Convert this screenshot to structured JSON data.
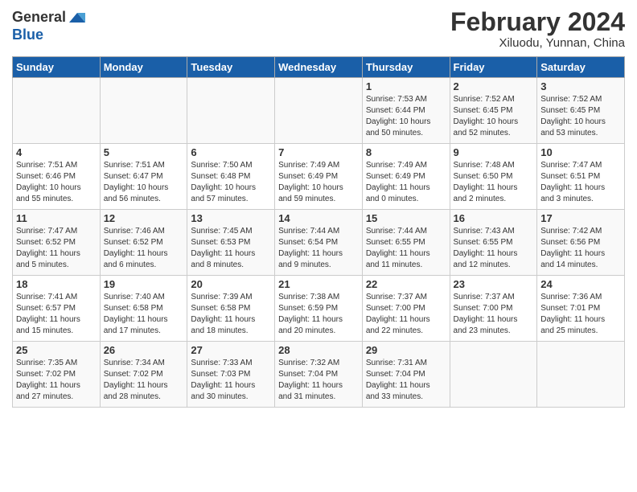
{
  "header": {
    "logo_line1": "General",
    "logo_line2": "Blue",
    "month": "February 2024",
    "location": "Xiluodu, Yunnan, China"
  },
  "days_of_week": [
    "Sunday",
    "Monday",
    "Tuesday",
    "Wednesday",
    "Thursday",
    "Friday",
    "Saturday"
  ],
  "weeks": [
    [
      {
        "num": "",
        "info": ""
      },
      {
        "num": "",
        "info": ""
      },
      {
        "num": "",
        "info": ""
      },
      {
        "num": "",
        "info": ""
      },
      {
        "num": "1",
        "info": "Sunrise: 7:53 AM\nSunset: 6:44 PM\nDaylight: 10 hours\nand 50 minutes."
      },
      {
        "num": "2",
        "info": "Sunrise: 7:52 AM\nSunset: 6:45 PM\nDaylight: 10 hours\nand 52 minutes."
      },
      {
        "num": "3",
        "info": "Sunrise: 7:52 AM\nSunset: 6:45 PM\nDaylight: 10 hours\nand 53 minutes."
      }
    ],
    [
      {
        "num": "4",
        "info": "Sunrise: 7:51 AM\nSunset: 6:46 PM\nDaylight: 10 hours\nand 55 minutes."
      },
      {
        "num": "5",
        "info": "Sunrise: 7:51 AM\nSunset: 6:47 PM\nDaylight: 10 hours\nand 56 minutes."
      },
      {
        "num": "6",
        "info": "Sunrise: 7:50 AM\nSunset: 6:48 PM\nDaylight: 10 hours\nand 57 minutes."
      },
      {
        "num": "7",
        "info": "Sunrise: 7:49 AM\nSunset: 6:49 PM\nDaylight: 10 hours\nand 59 minutes."
      },
      {
        "num": "8",
        "info": "Sunrise: 7:49 AM\nSunset: 6:49 PM\nDaylight: 11 hours\nand 0 minutes."
      },
      {
        "num": "9",
        "info": "Sunrise: 7:48 AM\nSunset: 6:50 PM\nDaylight: 11 hours\nand 2 minutes."
      },
      {
        "num": "10",
        "info": "Sunrise: 7:47 AM\nSunset: 6:51 PM\nDaylight: 11 hours\nand 3 minutes."
      }
    ],
    [
      {
        "num": "11",
        "info": "Sunrise: 7:47 AM\nSunset: 6:52 PM\nDaylight: 11 hours\nand 5 minutes."
      },
      {
        "num": "12",
        "info": "Sunrise: 7:46 AM\nSunset: 6:52 PM\nDaylight: 11 hours\nand 6 minutes."
      },
      {
        "num": "13",
        "info": "Sunrise: 7:45 AM\nSunset: 6:53 PM\nDaylight: 11 hours\nand 8 minutes."
      },
      {
        "num": "14",
        "info": "Sunrise: 7:44 AM\nSunset: 6:54 PM\nDaylight: 11 hours\nand 9 minutes."
      },
      {
        "num": "15",
        "info": "Sunrise: 7:44 AM\nSunset: 6:55 PM\nDaylight: 11 hours\nand 11 minutes."
      },
      {
        "num": "16",
        "info": "Sunrise: 7:43 AM\nSunset: 6:55 PM\nDaylight: 11 hours\nand 12 minutes."
      },
      {
        "num": "17",
        "info": "Sunrise: 7:42 AM\nSunset: 6:56 PM\nDaylight: 11 hours\nand 14 minutes."
      }
    ],
    [
      {
        "num": "18",
        "info": "Sunrise: 7:41 AM\nSunset: 6:57 PM\nDaylight: 11 hours\nand 15 minutes."
      },
      {
        "num": "19",
        "info": "Sunrise: 7:40 AM\nSunset: 6:58 PM\nDaylight: 11 hours\nand 17 minutes."
      },
      {
        "num": "20",
        "info": "Sunrise: 7:39 AM\nSunset: 6:58 PM\nDaylight: 11 hours\nand 18 minutes."
      },
      {
        "num": "21",
        "info": "Sunrise: 7:38 AM\nSunset: 6:59 PM\nDaylight: 11 hours\nand 20 minutes."
      },
      {
        "num": "22",
        "info": "Sunrise: 7:37 AM\nSunset: 7:00 PM\nDaylight: 11 hours\nand 22 minutes."
      },
      {
        "num": "23",
        "info": "Sunrise: 7:37 AM\nSunset: 7:00 PM\nDaylight: 11 hours\nand 23 minutes."
      },
      {
        "num": "24",
        "info": "Sunrise: 7:36 AM\nSunset: 7:01 PM\nDaylight: 11 hours\nand 25 minutes."
      }
    ],
    [
      {
        "num": "25",
        "info": "Sunrise: 7:35 AM\nSunset: 7:02 PM\nDaylight: 11 hours\nand 27 minutes."
      },
      {
        "num": "26",
        "info": "Sunrise: 7:34 AM\nSunset: 7:02 PM\nDaylight: 11 hours\nand 28 minutes."
      },
      {
        "num": "27",
        "info": "Sunrise: 7:33 AM\nSunset: 7:03 PM\nDaylight: 11 hours\nand 30 minutes."
      },
      {
        "num": "28",
        "info": "Sunrise: 7:32 AM\nSunset: 7:04 PM\nDaylight: 11 hours\nand 31 minutes."
      },
      {
        "num": "29",
        "info": "Sunrise: 7:31 AM\nSunset: 7:04 PM\nDaylight: 11 hours\nand 33 minutes."
      },
      {
        "num": "",
        "info": ""
      },
      {
        "num": "",
        "info": ""
      }
    ]
  ]
}
